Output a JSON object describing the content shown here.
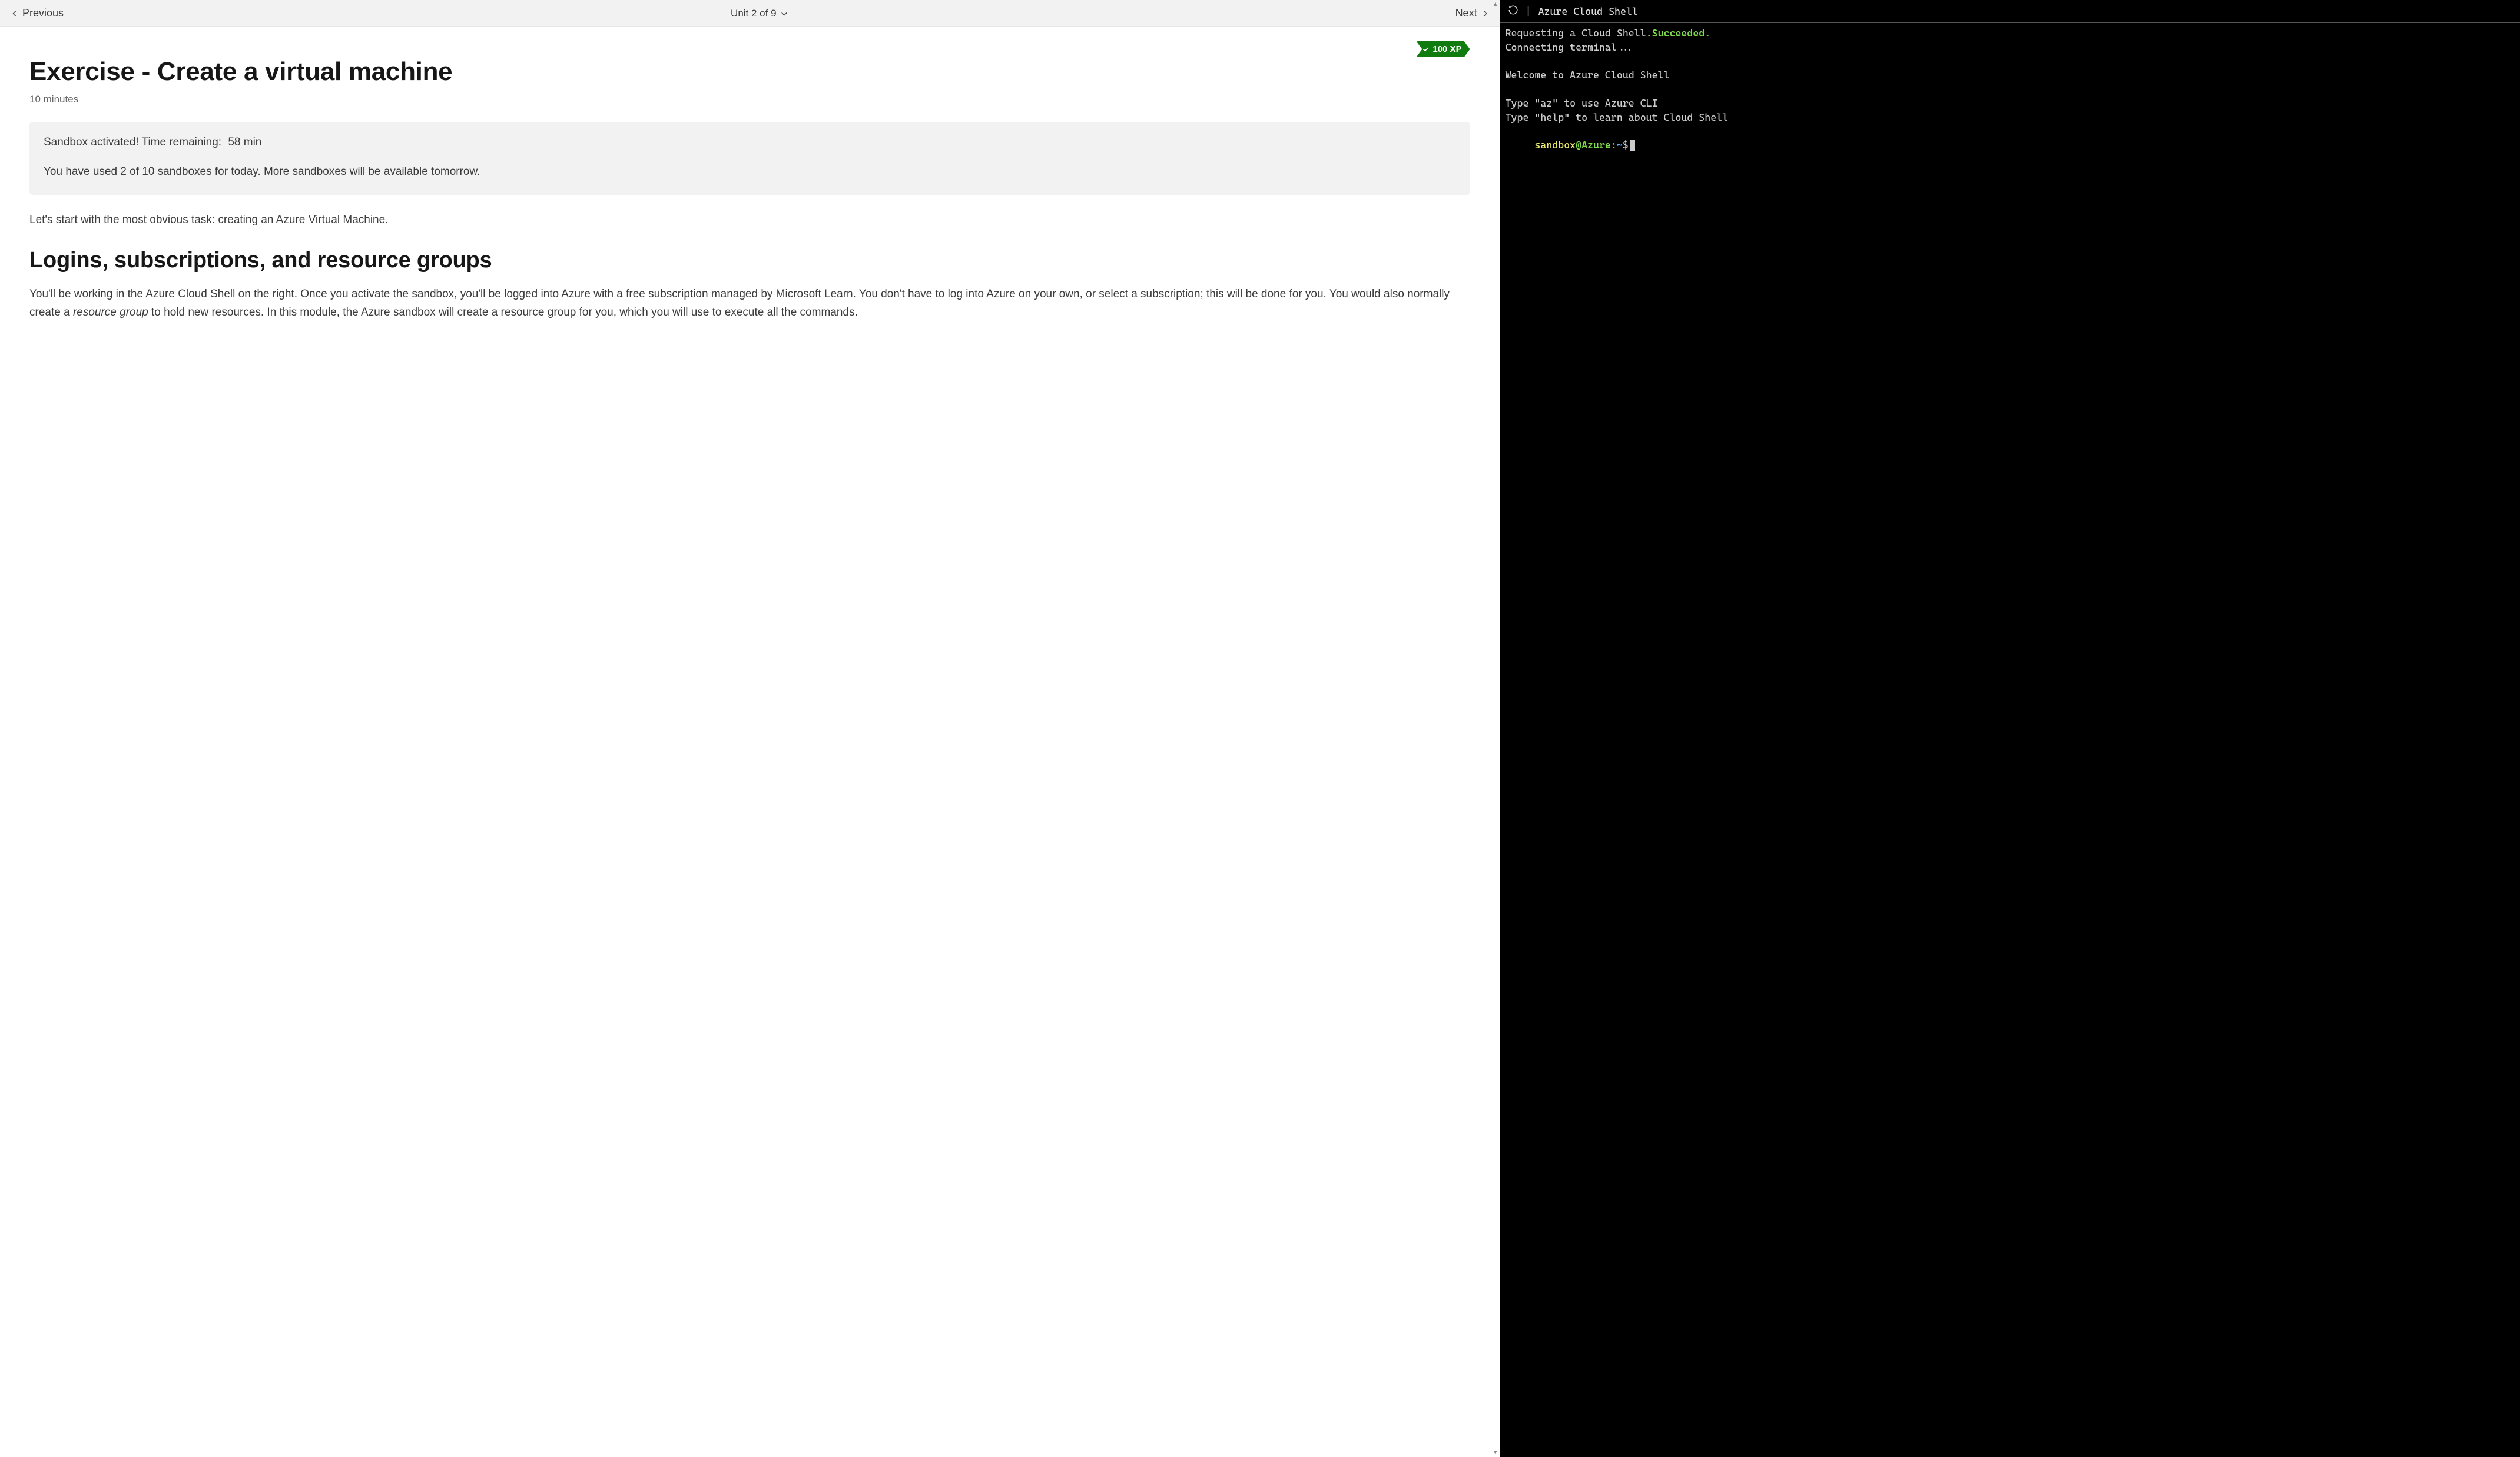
{
  "nav": {
    "prev_label": "Previous",
    "unit_indicator": "Unit 2 of 9",
    "next_label": "Next"
  },
  "xp_badge": "100 XP",
  "page": {
    "title": "Exercise - Create a virtual machine",
    "duration": "10 minutes"
  },
  "sandbox": {
    "line1_prefix": "Sandbox activated! Time remaining:",
    "time_remaining": "58 min",
    "line2": "You have used 2 of 10 sandboxes for today. More sandboxes will be available tomorrow."
  },
  "intro_paragraph": "Let's start with the most obvious task: creating an Azure Virtual Machine.",
  "section_heading": "Logins, subscriptions, and resource groups",
  "section_body_before_em": "You'll be working in the Azure Cloud Shell on the right. Once you activate the sandbox, you'll be logged into Azure with a free subscription managed by Microsoft Learn. You don't have to log into Azure on your own, or select a subscription; this will be done for you. You would also normally create a ",
  "section_body_em": "resource group",
  "section_body_after_em": " to hold new resources. In this module, the Azure sandbox will create a resource group for you, which you will use to execute all the commands.",
  "terminal": {
    "title": "Azure Cloud Shell",
    "lines": {
      "req_prefix": "Requesting a Cloud Shell.",
      "req_status": "Succeeded.",
      "connecting": "Connecting terminal...",
      "welcome": "Welcome to Azure Cloud Shell",
      "tip1": "Type \"az\" to use Azure CLI",
      "tip2": "Type \"help\" to learn about Cloud Shell"
    },
    "prompt": {
      "user": "sandbox",
      "at": "@Azure",
      "colon": ":",
      "path": "~",
      "symbol": "$"
    }
  }
}
